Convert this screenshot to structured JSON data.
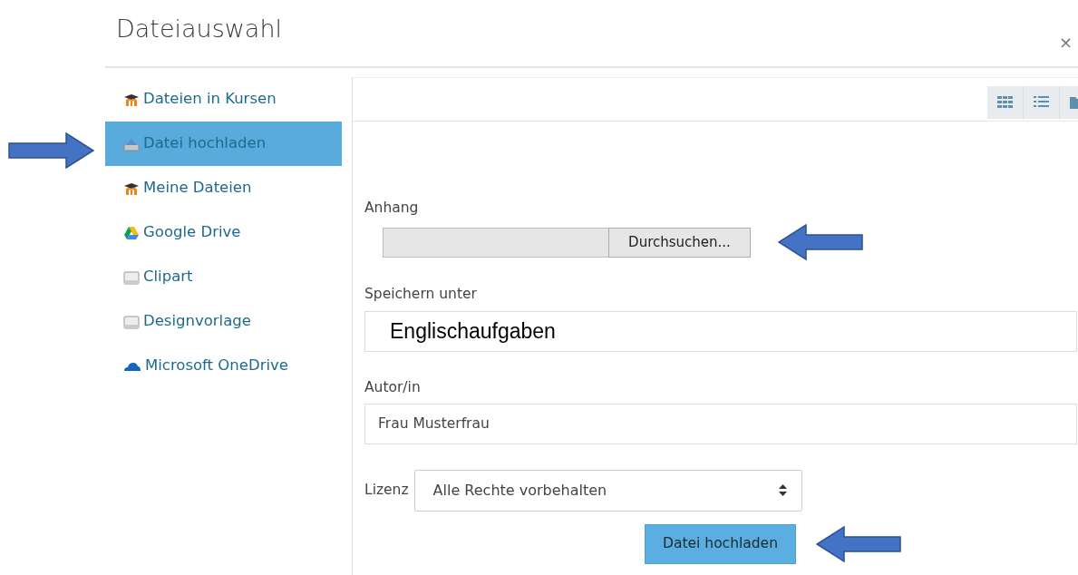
{
  "dialog": {
    "title": "Dateiauswahl",
    "close": "×"
  },
  "sidebar": {
    "items": [
      {
        "label": "Dateien in Kursen",
        "kind": "moodle",
        "selected": false,
        "pointer_arrow": false
      },
      {
        "label": "Datei hochladen",
        "kind": "upload",
        "selected": true,
        "pointer_arrow": true
      },
      {
        "label": "Meine Dateien",
        "kind": "moodle",
        "selected": false,
        "pointer_arrow": false
      },
      {
        "label": "Google Drive",
        "kind": "drive",
        "selected": false,
        "pointer_arrow": false
      },
      {
        "label": "Clipart",
        "kind": "repository",
        "selected": false,
        "pointer_arrow": false
      },
      {
        "label": "Designvorlage",
        "kind": "repository",
        "selected": false,
        "pointer_arrow": false
      },
      {
        "label": "Microsoft OneDrive",
        "kind": "cloud",
        "selected": false,
        "pointer_arrow": false
      }
    ]
  },
  "toolbar": {
    "views": [
      {
        "kind": "grid",
        "selected": false
      },
      {
        "kind": "list",
        "selected": false
      },
      {
        "kind": "folder",
        "selected": false
      }
    ]
  },
  "form": {
    "attachment": {
      "label": "Anhang",
      "browse_button": "Durchsuchen...",
      "pointer_arrow": true
    },
    "save_as": {
      "label": "Speichern unter",
      "value": "Englischaufgaben"
    },
    "author": {
      "label": "Autor/in",
      "value": "Frau Musterfrau"
    },
    "license": {
      "label": "Lizenz",
      "value": "Alle Rechte vorbehalten"
    },
    "upload_button": {
      "label": "Datei hochladen",
      "pointer_arrow": true
    }
  }
}
